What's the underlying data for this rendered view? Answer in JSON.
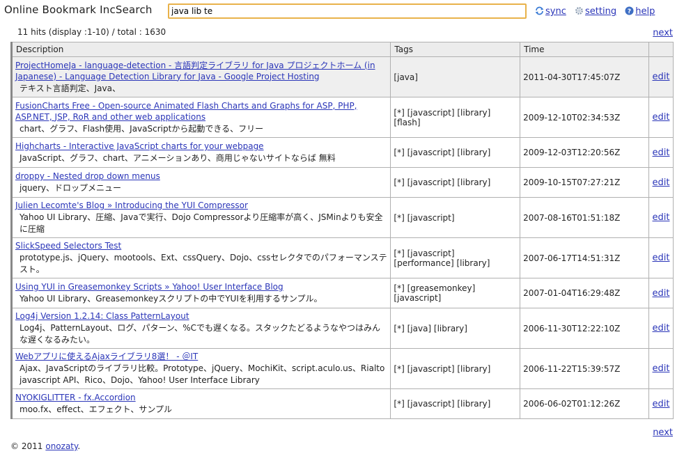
{
  "app": {
    "title": "Online Bookmark IncSearch"
  },
  "search": {
    "value": "java lib te"
  },
  "top_links": [
    {
      "label": "sync",
      "icon": "sync-icon"
    },
    {
      "label": "setting",
      "icon": "gear-icon"
    },
    {
      "label": "help",
      "icon": "help-icon"
    }
  ],
  "summary": {
    "text": "11 hits (display :1-10) / total : 1630",
    "next_label": "next"
  },
  "table": {
    "headers": [
      "Description",
      "Tags",
      "Time",
      ""
    ],
    "rows": [
      {
        "title": "ProjectHomeJa - language-detection - 言語判定ライブラリ for Java プロジェクトホーム (in Japanese) - Language Detection Library for Java - Google Project Hosting",
        "note": "テキスト言語判定、Java、",
        "tags": "[java]",
        "time": "2011-04-30T17:45:07Z",
        "action": "edit",
        "selected": true
      },
      {
        "title": "FusionCharts Free - Open-source Animated Flash Charts and Graphs for ASP, PHP, ASP.NET, JSP, RoR and other web applications",
        "note": "chart、グラフ、Flash使用、JavaScriptから起動できる、フリー",
        "tags": "[*] [javascript] [library] [flash]",
        "time": "2009-12-10T02:34:53Z",
        "action": "edit"
      },
      {
        "title": "Highcharts - Interactive JavaScript charts for your webpage",
        "note": "JavaScript、グラフ、chart、アニメーションあり、商用じゃないサイトならば 無料",
        "tags": "[*] [javascript] [library]",
        "time": "2009-12-03T12:20:56Z",
        "action": "edit"
      },
      {
        "title": "droppy - Nested drop down menus",
        "note": "jquery、ドロップメニュー",
        "tags": "[*] [javascript] [library]",
        "time": "2009-10-15T07:27:21Z",
        "action": "edit"
      },
      {
        "title": "Julien Lecomte's Blog » Introducing the YUI Compressor",
        "note": "Yahoo UI Library、圧縮、Javaで実行、Dojo Compressorより圧縮率が高く、JSMinよりも安全に圧縮",
        "tags": "[*] [javascript]",
        "time": "2007-08-16T01:51:18Z",
        "action": "edit"
      },
      {
        "title": "SlickSpeed Selectors Test",
        "note": "prototype.js、jQuery、mootools、Ext、cssQuery、Dojo、cssセレクタでのパフォーマンステスト。",
        "tags": "[*] [javascript] [performance] [library]",
        "time": "2007-06-17T14:51:31Z",
        "action": "edit"
      },
      {
        "title": "Using YUI in Greasemonkey Scripts » Yahoo! User Interface Blog",
        "note": "Yahoo UI Library、Greasemonkeyスクリプトの中でYUIを利用するサンプル。",
        "tags": "[*] [greasemonkey] [javascript]",
        "time": "2007-01-04T16:29:48Z",
        "action": "edit"
      },
      {
        "title": "Log4j Version 1.2.14: Class PatternLayout",
        "note": "Log4j、PatternLayout、ログ、パターン、%Cでも遅くなる。スタックたどるようなやつはみんな遅くなるみたい。",
        "tags": "[*] [java] [library]",
        "time": "2006-11-30T12:22:10Z",
        "action": "edit"
      },
      {
        "title": "Webアプリに使えるAjaxライブラリ8選！ - ＠IT",
        "note": "Ajax、JavaScriptのライブラリ比較。Prototype、jQuery、MochiKit、script.aculo.us、Rialto javascript API、Rico、Dojo、Yahoo! User Interface Library",
        "tags": "[*] [javascript] [library]",
        "time": "2006-11-22T15:39:57Z",
        "action": "edit"
      },
      {
        "title": "NYOKIGLITTER - fx.Accordion",
        "note": "moo.fx、effect、エフェクト、サンプル",
        "tags": "[*] [javascript] [library]",
        "time": "2006-06-02T01:12:26Z",
        "action": "edit"
      }
    ]
  },
  "footer": {
    "copyright": "© 2011",
    "author": "onozaty",
    "suffix": ".",
    "next_label": "next"
  }
}
